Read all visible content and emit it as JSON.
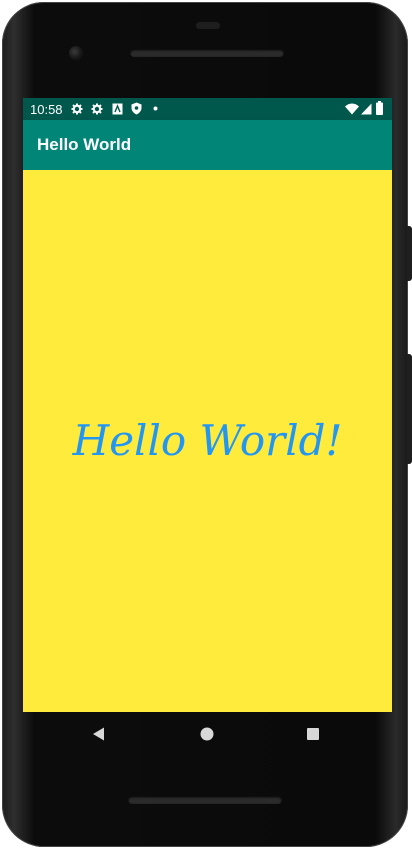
{
  "status_bar": {
    "time": "10:58",
    "icons": [
      "gear-icon",
      "gear-icon",
      "a-box-icon",
      "shield-icon",
      "dot-icon"
    ],
    "right_icons": [
      "wifi-icon",
      "signal-icon",
      "battery-icon"
    ]
  },
  "app_bar": {
    "title": "Hello World"
  },
  "main": {
    "greeting": "Hello World!"
  },
  "nav_bar": {
    "buttons": [
      "back-icon",
      "home-icon",
      "recents-icon"
    ]
  },
  "colors": {
    "status_bar": "#00574b",
    "app_bar": "#008577",
    "background": "#ffeb3b",
    "greeting": "#2196f3"
  }
}
